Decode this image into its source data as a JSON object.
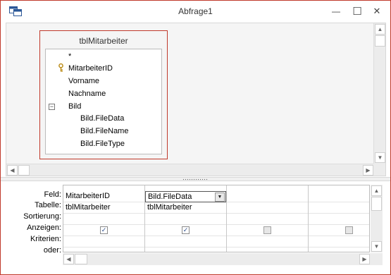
{
  "window": {
    "title": "Abfrage1"
  },
  "title_buttons": {
    "minimize": "—",
    "maximize": "☐",
    "close": "✕"
  },
  "table": {
    "name": "tblMitarbeiter",
    "fields": [
      {
        "label": "*",
        "indent": 0
      },
      {
        "label": "MitarbeiterID",
        "indent": 0,
        "primary_key": true
      },
      {
        "label": "Vorname",
        "indent": 0
      },
      {
        "label": "Nachname",
        "indent": 0
      },
      {
        "label": "Bild",
        "indent": 0,
        "expanded": true,
        "expander": "⊟"
      },
      {
        "label": "Bild.FileData",
        "indent": 1
      },
      {
        "label": "Bild.FileName",
        "indent": 1
      },
      {
        "label": "Bild.FileType",
        "indent": 1
      }
    ]
  },
  "grid": {
    "row_labels": [
      "Feld:",
      "Tabelle:",
      "Sortierung:",
      "Anzeigen:",
      "Kriterien:",
      "oder:"
    ],
    "columns": [
      {
        "feld": "MitarbeiterID",
        "tabelle": "tblMitarbeiter",
        "anzeigen": true
      },
      {
        "feld": "Bild.FileData",
        "tabelle": "tblMitarbeiter",
        "anzeigen": true,
        "selected": true
      },
      {
        "feld": "",
        "tabelle": "",
        "anzeigen": false
      },
      {
        "feld": "",
        "tabelle": "",
        "anzeigen": false
      }
    ]
  },
  "icons": {
    "app": "query-design-icon",
    "key": "primary-key-icon",
    "collapse": "collapse-icon",
    "dropdown": "dropdown-arrow-icon"
  }
}
